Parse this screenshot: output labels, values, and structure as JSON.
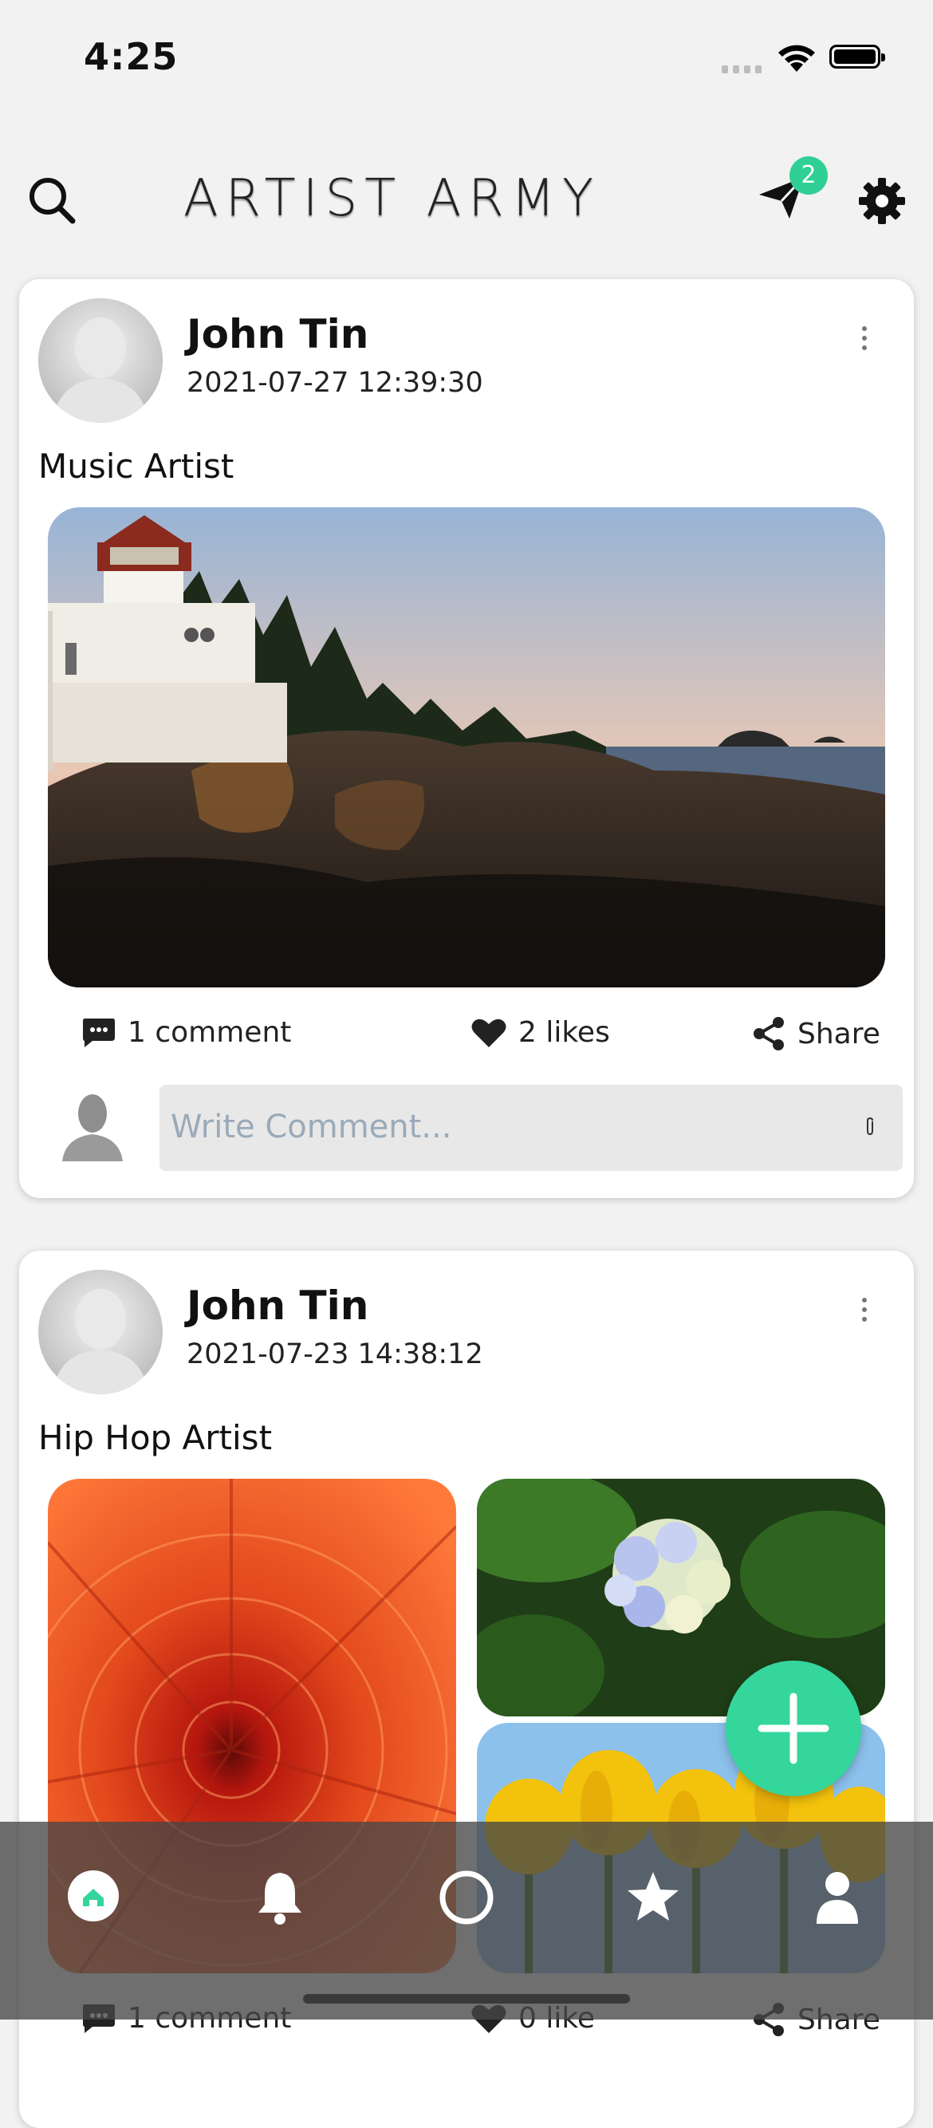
{
  "status_bar": {
    "time": "4:25"
  },
  "header": {
    "title": "ARTIST ARMY",
    "message_badge_count": "2",
    "icons": [
      "search-icon",
      "paper-plane-icon",
      "gear-icon"
    ]
  },
  "posts": [
    {
      "author": "John Tin",
      "timestamp": "2021-07-27 12:39:30",
      "caption": "Music Artist",
      "comments": "1 comment",
      "likes": "2 likes",
      "share": "Share",
      "comment_placeholder": "Write Comment..."
    },
    {
      "author": "John Tin",
      "timestamp": "2021-07-23 14:38:12",
      "caption": "Hip Hop Artist",
      "comments": "1 comment",
      "likes": "0 like",
      "share": "Share"
    }
  ],
  "bottom_nav": {
    "items": [
      "home-icon",
      "bell-icon",
      "circle-icon",
      "star-icon",
      "user-icon"
    ],
    "active": "home-icon"
  },
  "colors": {
    "accent": "#34d69c",
    "badge": "#2fcf96",
    "nav_bg": "#464646"
  }
}
